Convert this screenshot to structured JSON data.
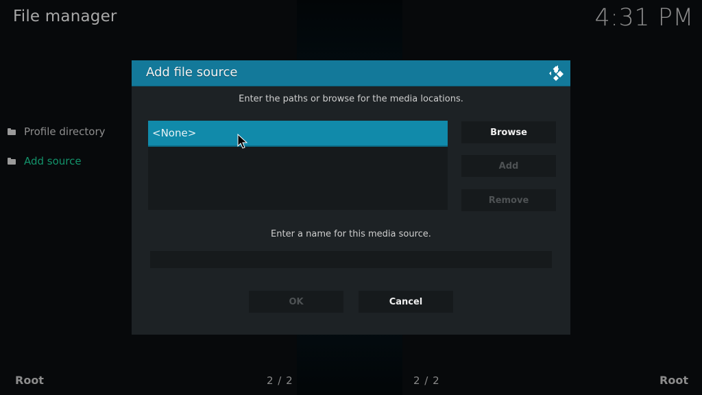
{
  "app": {
    "title": "File manager",
    "clock": "4:31 PM"
  },
  "sidebar": {
    "items": [
      {
        "label": "Profile directory",
        "icon": "folder-icon",
        "active": false
      },
      {
        "label": "Add source",
        "icon": "folder-icon",
        "active": true
      }
    ]
  },
  "dialog": {
    "title": "Add file source",
    "logo_icon": "kodi-logo-icon",
    "paths_instruction": "Enter the paths or browse for the media locations.",
    "paths": [
      {
        "value": "<None>",
        "selected": true
      }
    ],
    "buttons": {
      "browse": {
        "label": "Browse",
        "enabled": true
      },
      "add": {
        "label": "Add",
        "enabled": false
      },
      "remove": {
        "label": "Remove",
        "enabled": false
      }
    },
    "name_instruction": "Enter a name for this media source.",
    "name_value": "",
    "ok": {
      "label": "OK",
      "enabled": false
    },
    "cancel": {
      "label": "Cancel",
      "enabled": true
    }
  },
  "footer": {
    "left_label": "Root",
    "left_page": "2 / 2",
    "right_page": "2 / 2",
    "right_label": "Root"
  },
  "colors": {
    "accent": "#13799a",
    "selection": "#118aaa",
    "active_sidebar": "#13936b",
    "dialog_bg": "#1d2225"
  }
}
